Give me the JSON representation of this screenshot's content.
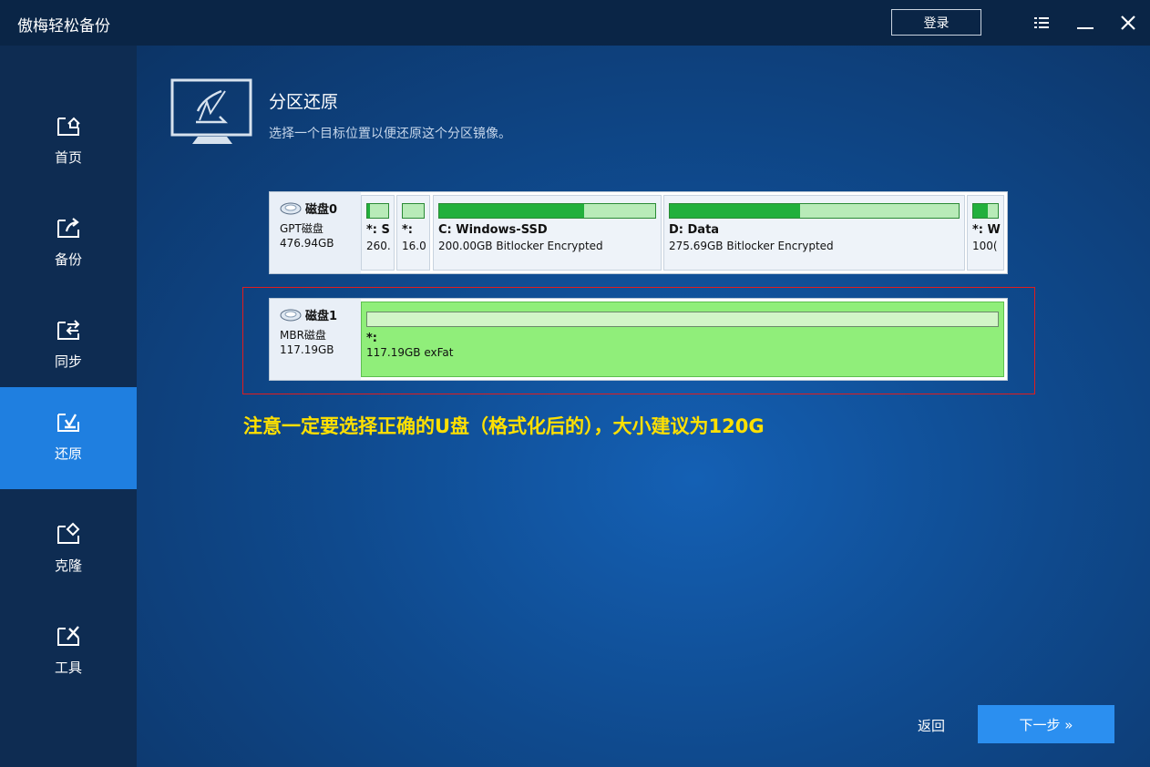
{
  "app": {
    "title": "傲梅轻松备份",
    "login_label": "登录"
  },
  "sidebar": {
    "items": [
      {
        "label": "首页",
        "icon": "home-icon"
      },
      {
        "label": "备份",
        "icon": "backup-icon"
      },
      {
        "label": "同步",
        "icon": "sync-icon"
      },
      {
        "label": "还原",
        "icon": "restore-icon",
        "active": true
      },
      {
        "label": "克隆",
        "icon": "clone-icon"
      },
      {
        "label": "工具",
        "icon": "tools-icon"
      }
    ]
  },
  "header": {
    "title": "分区还原",
    "subtitle": "选择一个目标位置以便还原这个分区镜像。"
  },
  "disks": [
    {
      "name": "磁盘0",
      "type": "GPT磁盘",
      "size": "476.94GB",
      "partitions": [
        {
          "name": "*: S",
          "desc": "260.",
          "used_fraction": 0.15
        },
        {
          "name": "*:",
          "desc": "16.0",
          "used_fraction": 0.0
        },
        {
          "name": "C: Windows-SSD",
          "desc": "200.00GB Bitlocker Encrypted",
          "used_fraction": 0.67
        },
        {
          "name": "D: Data",
          "desc": "275.69GB Bitlocker Encrypted",
          "used_fraction": 0.45
        },
        {
          "name": "*: W",
          "desc": "100(",
          "used_fraction": 0.6
        }
      ]
    },
    {
      "name": "磁盘1",
      "type": "MBR磁盘",
      "size": "117.19GB",
      "partitions": [
        {
          "name": "*:",
          "desc": "117.19GB exFat",
          "used_fraction": 0.0,
          "selected": true
        }
      ]
    }
  ],
  "warning": "注意一定要选择正确的U盘（格式化后的），大小建议为120G",
  "footer": {
    "back_label": "返回",
    "next_label": "下一步 »"
  },
  "colors": {
    "active_nav": "#1f7fe0",
    "warning_text": "#ffe000",
    "highlight_border": "#e21c1c",
    "partition_fill": "#22b03c",
    "selected_partition": "#90ee7a"
  }
}
